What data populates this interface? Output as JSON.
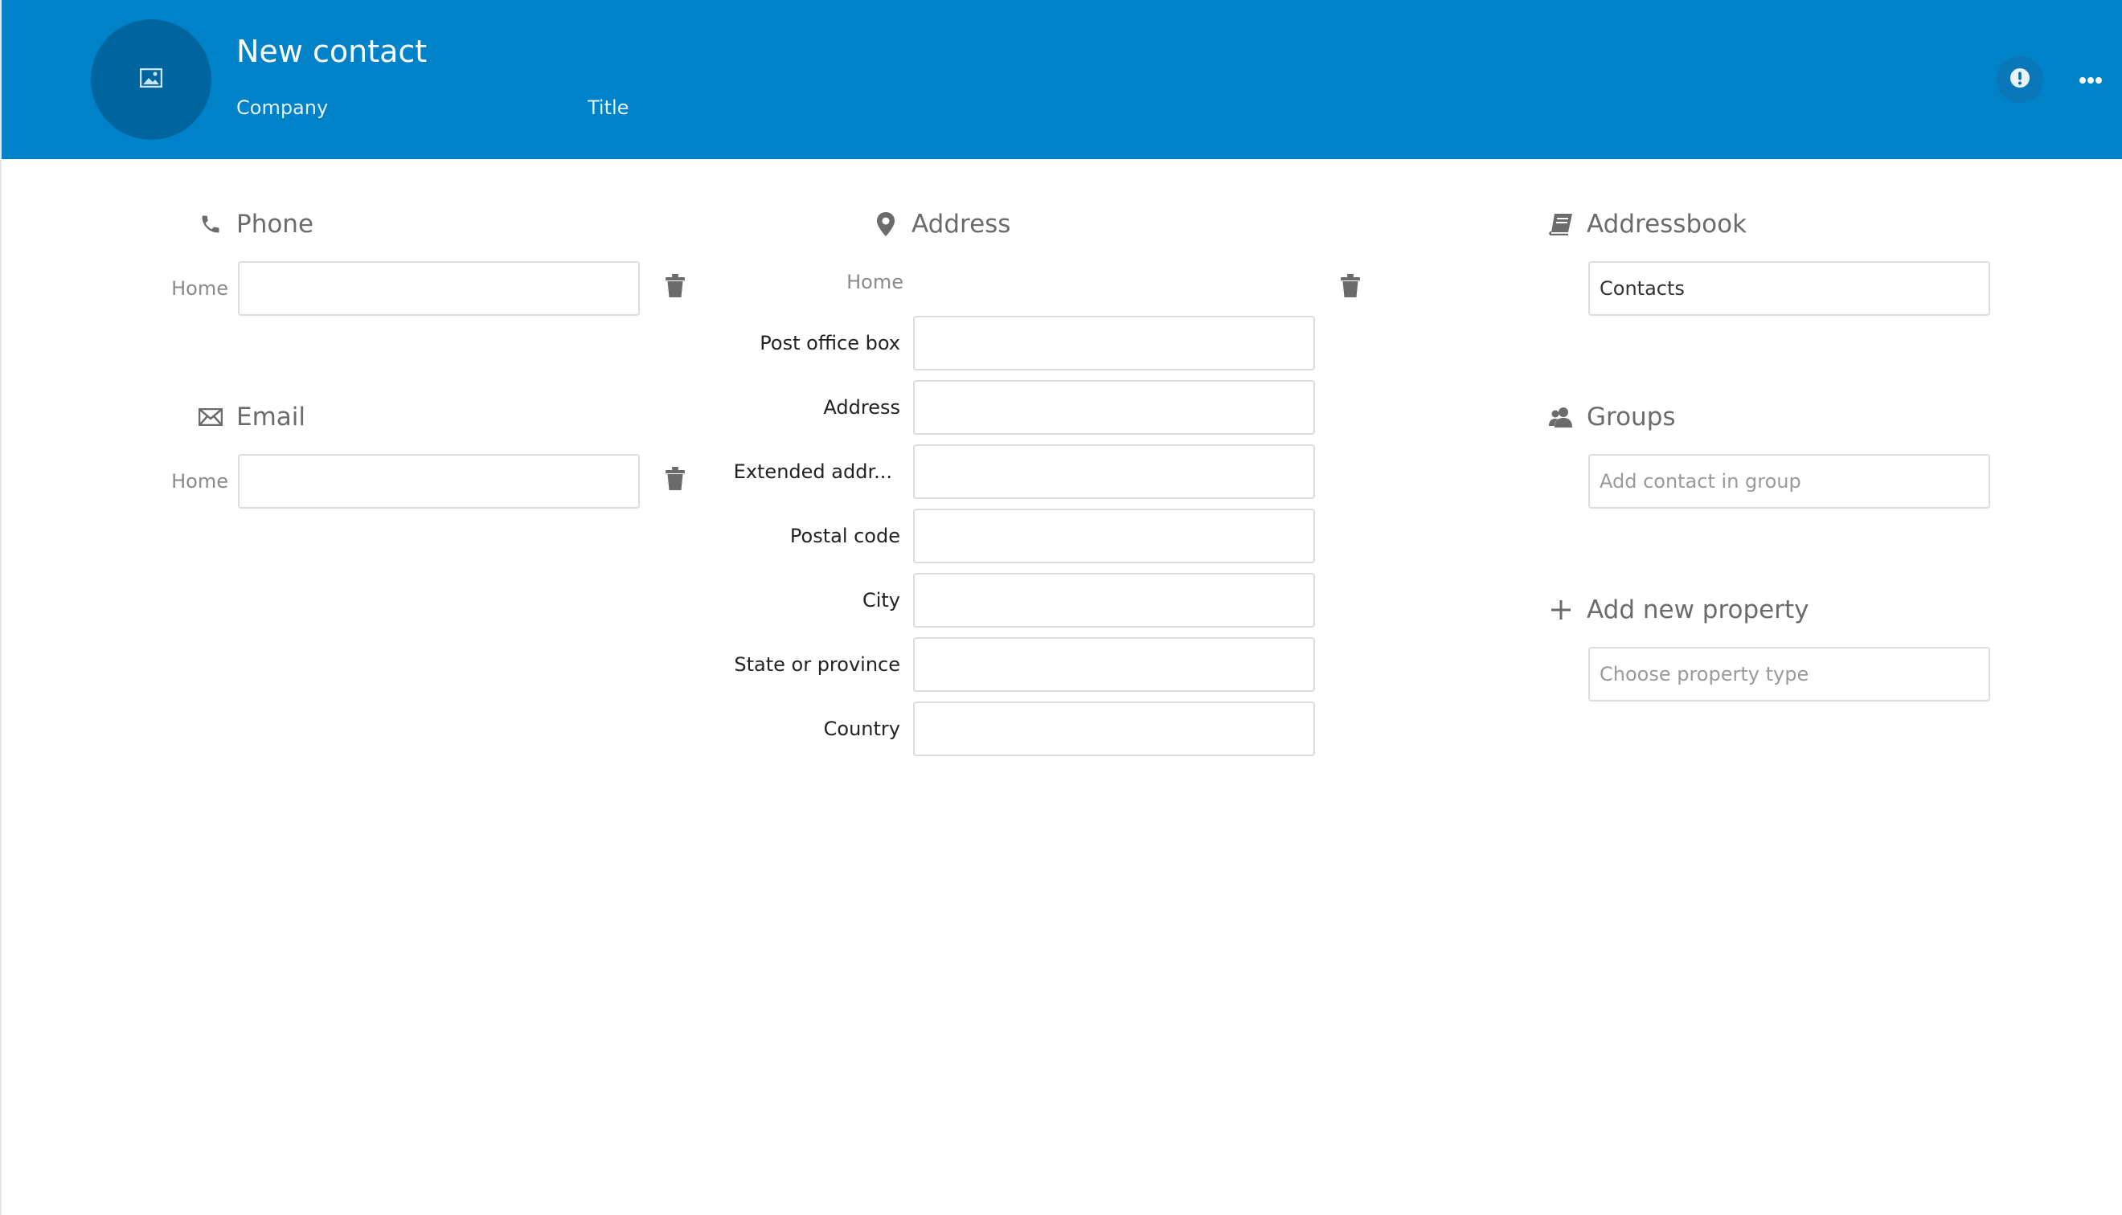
{
  "header": {
    "name_placeholder": "New contact",
    "company_placeholder": "Company",
    "title_placeholder": "Title",
    "background_color": "#0082c9",
    "avatar_icon": "image-icon",
    "warning_icon": "alert-circle-icon",
    "more_icon": "more-horizontal-icon"
  },
  "phone": {
    "title": "Phone",
    "icon": "phone-icon",
    "type_label": "Home",
    "value": "",
    "delete_icon": "trash-icon"
  },
  "email": {
    "title": "Email",
    "icon": "mail-icon",
    "type_label": "Home",
    "value": "",
    "delete_icon": "trash-icon"
  },
  "address": {
    "title": "Address",
    "icon": "map-marker-icon",
    "type_label": "Home",
    "delete_icon": "trash-icon",
    "fields": [
      {
        "label": "Post office box",
        "value": ""
      },
      {
        "label": "Address",
        "value": ""
      },
      {
        "label": "Extended addr...",
        "value": ""
      },
      {
        "label": "Postal code",
        "value": ""
      },
      {
        "label": "City",
        "value": ""
      },
      {
        "label": "State or province",
        "value": ""
      },
      {
        "label": "Country",
        "value": ""
      }
    ]
  },
  "addressbook": {
    "title": "Addressbook",
    "icon": "book-icon",
    "selected": "Contacts"
  },
  "groups": {
    "title": "Groups",
    "icon": "people-icon",
    "placeholder": "Add contact in group"
  },
  "add_property": {
    "title": "Add new property",
    "icon": "plus-icon",
    "placeholder": "Choose property type"
  }
}
